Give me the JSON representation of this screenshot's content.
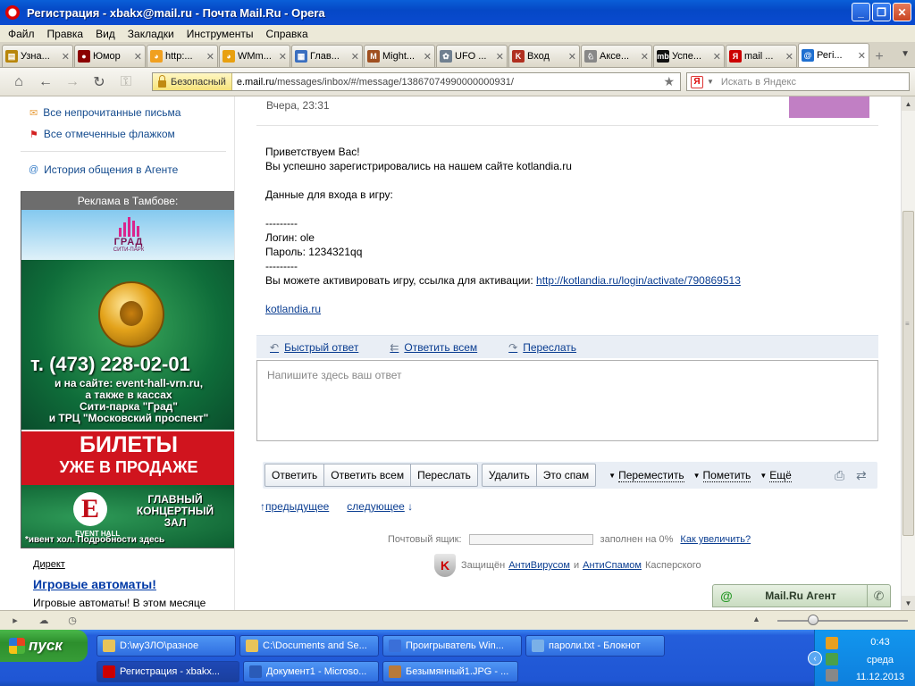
{
  "window": {
    "title": "Регистрация - xbakx@mail.ru - Почта Mail.Ru - Opera",
    "minimize": "_",
    "maximize": "❐",
    "close": "✕"
  },
  "menu": [
    "Файл",
    "Правка",
    "Вид",
    "Закладки",
    "Инструменты",
    "Справка"
  ],
  "tabs": [
    {
      "label": "Узна...",
      "icon_color": "#b8860b",
      "icon_glyph": "▤"
    },
    {
      "label": "Юмор",
      "icon_color": "#8b0000",
      "icon_glyph": "●"
    },
    {
      "label": "http:...",
      "icon_color": "#f0a020",
      "icon_glyph": "◕"
    },
    {
      "label": "WMm...",
      "icon_color": "#e8a010",
      "icon_glyph": "◕"
    },
    {
      "label": "Глав...",
      "icon_color": "#3a6fc0",
      "icon_glyph": "▦"
    },
    {
      "label": "Might...",
      "icon_color": "#a05020",
      "icon_glyph": "M"
    },
    {
      "label": "UFO ...",
      "icon_color": "#708090",
      "icon_glyph": "✿"
    },
    {
      "label": "Вход",
      "icon_color": "#b03020",
      "icon_glyph": "K"
    },
    {
      "label": "Аксе...",
      "icon_color": "#888888",
      "icon_glyph": "♘"
    },
    {
      "label": "Успе...",
      "icon_color": "#111111",
      "icon_glyph": "mb"
    },
    {
      "label": "mail ...",
      "icon_color": "#cc0000",
      "icon_glyph": "Я"
    },
    {
      "label": "Регі...",
      "icon_color": "#1e6fd0",
      "icon_glyph": "@",
      "active": true
    }
  ],
  "addressbar": {
    "secure_label": "Безопасный",
    "url_host": "e.mail.ru",
    "url_path": "/messages/inbox/#/message/13867074990000000931/",
    "search_placeholder": "Искать в Яндекс",
    "search_engine_icon": "Я"
  },
  "sidebar": {
    "links": [
      {
        "label": "Все непрочитанные письма",
        "icon": "envelope-icon"
      },
      {
        "label": "Все отмеченные флажком",
        "icon": "flag-icon"
      },
      {
        "label": "История общения в Агенте",
        "icon": "at-icon"
      }
    ],
    "ad": {
      "header": "Реклама в Тамбове:",
      "logo": "ГРАД",
      "logo_sub": "СИТИ-ПАРК",
      "phone": "т. (473) 228-02-01",
      "text_lines": [
        "и на сайте: event-hall-vrn.ru,",
        "а также в кассах",
        "Сити-парка \"Град\"",
        "и ТРЦ \"Московский проспект\""
      ],
      "banner_line1": "БИЛЕТЫ",
      "banner_line2": "УЖЕ В ПРОДАЖЕ",
      "hall_letter": "E",
      "hall_caption": "EVENT HALL",
      "hall_lines": [
        "ГЛАВНЫЙ",
        "КОНЦЕРТНЫЙ",
        "ЗАЛ"
      ],
      "footnote": "*ивент хол. Подробности здесь"
    },
    "direct_label": "Директ",
    "game_link": "Игровые автоматы!",
    "game_text": "Игровые автоматы! В этом месяце"
  },
  "message": {
    "date": "Вчера, 23:31",
    "body": [
      "Приветствуем Вас!",
      "Вы успешно зарегистрировались на нашем сайте kotlandia.ru",
      "Данные для входа в игру:",
      "---------",
      "Логин: ole",
      "Пароль: 1234321qq",
      "---------",
      "Вы можете активировать игру, ссылка для активации:"
    ],
    "activation_link": "http://kotlandia.ru/login/activate/790869513",
    "site_link": "kotlandia.ru"
  },
  "reply_bar": {
    "quick_reply": "Быстрый ответ",
    "reply_all": "Ответить всем",
    "forward": "Переслать",
    "placeholder": "Напишите здесь ваш ответ"
  },
  "toolbar": {
    "reply": "Ответить",
    "reply_all": "Ответить всем",
    "forward": "Переслать",
    "delete": "Удалить",
    "spam": "Это спам",
    "move": "Переместить",
    "mark": "Пометить",
    "more": "Ещё"
  },
  "pager": {
    "prev": "предыдущее",
    "next": "следующее"
  },
  "quota": {
    "label": "Почтовый ящик:",
    "used_percent": 0,
    "used_text": "заполнен на 0%",
    "increase_link": "Как увеличить?"
  },
  "protection": {
    "prefix": "Защищён",
    "antivirus": "АнтиВирусом",
    "and": "и",
    "antispam": "АнтиСпамом",
    "suffix": "Касперского"
  },
  "agent": {
    "label": "Mail.Ru Агент"
  },
  "taskbar": {
    "start_label": "пуск",
    "row1": [
      {
        "label": "D:\\муЗЛО\\разное",
        "icon_color": "#e8c45a"
      },
      {
        "label": "C:\\Documents and Se...",
        "icon_color": "#e8c45a"
      },
      {
        "label": "Проигрыватель Win...",
        "icon_color": "#3a6fd8"
      },
      {
        "label": "пароли.txt - Блокнот",
        "icon_color": "#7ab0e8"
      }
    ],
    "row2": [
      {
        "label": "Регистрация - xbakx...",
        "icon_color": "#cc0000",
        "active": true
      },
      {
        "label": "Документ1 - Microso...",
        "icon_color": "#2a5bb8"
      },
      {
        "label": "Безымянный1.JPG - ...",
        "icon_color": "#b87a3a"
      }
    ],
    "clock": {
      "time": "0:43",
      "day": "среда",
      "date": "11.12.2013"
    }
  }
}
